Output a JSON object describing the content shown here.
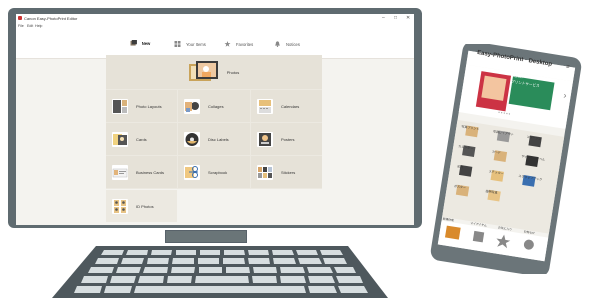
{
  "window": {
    "title": "Canon Easy-PhotoPrint Editor",
    "controls": [
      "–",
      "□",
      "✕"
    ]
  },
  "menu": {
    "items": [
      "File",
      "Edit",
      "Help"
    ]
  },
  "tabs": [
    {
      "label": "New",
      "icon": "new-icon",
      "active": true
    },
    {
      "label": "Your Items",
      "icon": "grid-icon",
      "active": false
    },
    {
      "label": "Favorites",
      "icon": "star-icon",
      "active": false
    },
    {
      "label": "Notices",
      "icon": "bell-icon",
      "active": false
    }
  ],
  "categories": {
    "photos": "Photos",
    "photo_layouts": "Photo Layouts",
    "collages": "Collages",
    "calendars": "Calendars",
    "cards": "Cards",
    "disc_labels": "Disc Labels",
    "posters": "Posters",
    "business_cards": "Business Cards",
    "scrapbook": "Scrapbook",
    "stickers": "Stickers",
    "id_photos": "ID Photos"
  },
  "phone": {
    "title": "Easy-PhotoPrint · Desktop",
    "banner_line1": "Canon",
    "banner_line2": "プリントサービス",
    "pager": "● ● ● ● ●",
    "grid_labels": [
      "写真プリント",
      "写真レイアウト",
      "コラージュ",
      "カレンダー",
      "カード",
      "ディスクレーベル",
      "名刺",
      "ステッカー",
      "スクラップブック",
      "ポスター",
      "証明写真"
    ],
    "bottom_tabs": [
      "新規作成",
      "マイアイテム",
      "お気に入り",
      "お知らせ"
    ]
  },
  "colors": {
    "accent": "#d98a2b",
    "bezel": "#5f6b70",
    "screen_bg": "#f4f3ef",
    "panel_bg": "#ece9e1"
  }
}
